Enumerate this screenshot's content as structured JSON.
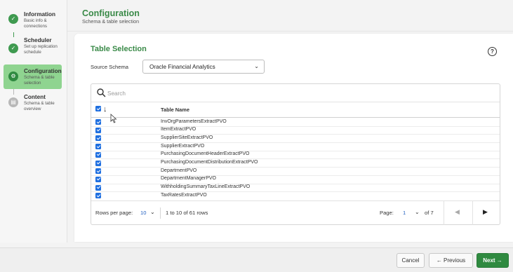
{
  "stepper": {
    "steps": [
      {
        "title": "Information",
        "desc": "Basic info & connections",
        "state": "done"
      },
      {
        "title": "Scheduler",
        "desc": "Set up replication schedule",
        "state": "done"
      },
      {
        "title": "Configuration",
        "desc": "Schema & table selection",
        "state": "active"
      },
      {
        "title": "Content",
        "desc": "Schema & table overview",
        "state": "pending"
      }
    ],
    "check_glyph": "✓",
    "active_glyph": "⚙",
    "pending_glyph": "▤"
  },
  "header": {
    "title": "Configuration",
    "subtitle": "Schema & table selection"
  },
  "section": {
    "title": "Table Selection",
    "help_glyph": "?"
  },
  "source_schema": {
    "label": "Source Schema",
    "value": "Oracle Financial Analytics"
  },
  "search": {
    "placeholder": "Search",
    "value": ""
  },
  "table": {
    "header_name": "Table Name",
    "rows": [
      "InvOrgParametersExtractPVO",
      "ItemExtractPVO",
      "SupplierSiteExtractPVO",
      "SupplierExtractPVO",
      "PurchasingDocumentHeaderExtractPVO",
      "PurchasingDocumentDistributionExtractPVO",
      "DepartmentPVO",
      "DepartmentManagerPVO",
      "WithholdingSummaryTaxLineExtractPVO",
      "TaxRatesExtractPVO"
    ]
  },
  "pagination": {
    "rows_per_page_label": "Rows per page:",
    "rows_per_page_value": "10",
    "range": "1 to 10 of 61 rows",
    "page_label": "Page:",
    "page_value": "1",
    "of_pages": "of 7"
  },
  "buttons": {
    "cancel": "Cancel",
    "previous": "← Previous",
    "next": "Next →"
  },
  "colors": {
    "accent_green": "#3a8a48",
    "active_step": "#8fd490",
    "checkbox_blue": "#1f6fe0"
  }
}
